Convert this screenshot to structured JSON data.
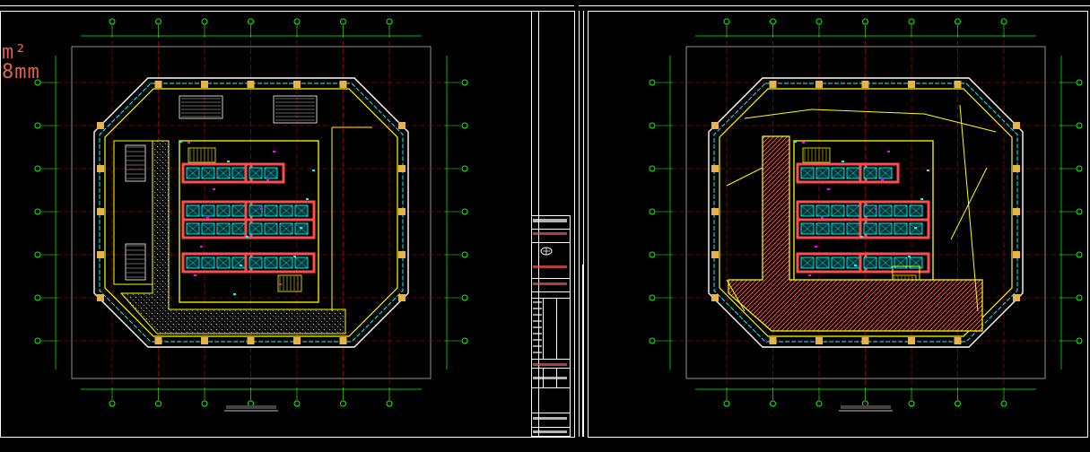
{
  "canvas": {
    "background": "#000000",
    "colors": {
      "frame": "#ffffff",
      "grid": "#c80000",
      "axis": "#00ff00",
      "wall": "#ffff00",
      "column": "#e6b34d",
      "core": "#ff4d4d",
      "elevator": "#00ffff",
      "hatch": "#c8c8c8",
      "hatch_red": "#ff5555",
      "window": "#00ffff",
      "magenta": "#ff00ff",
      "text": "#e0614a"
    }
  },
  "partial_labels": {
    "area_unit": "m²",
    "dim_unit": "8mm"
  },
  "drawing_sheets": [
    {
      "id": "left-plan",
      "icon": "floor-plan-icon"
    },
    {
      "id": "right-plan",
      "icon": "floor-plan-icon"
    }
  ],
  "title_block": {
    "icon": "company-logo-icon"
  }
}
